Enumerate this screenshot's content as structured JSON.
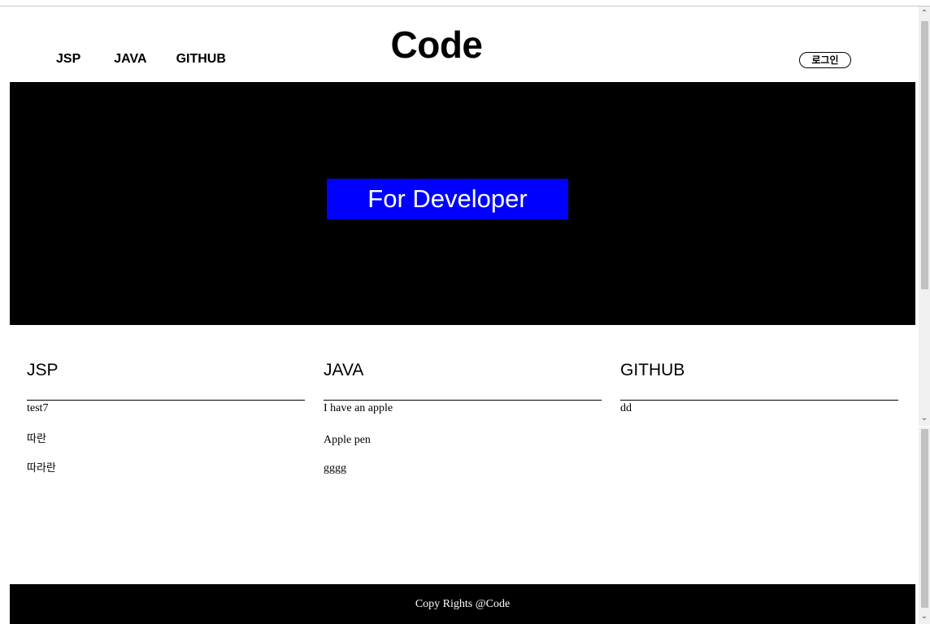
{
  "header": {
    "nav": [
      "JSP",
      "JAVA",
      "GITHUB"
    ],
    "logo": "Code",
    "login_label": "로그인"
  },
  "hero": {
    "tagline": "For Developer"
  },
  "sections": [
    {
      "title": "JSP",
      "items": [
        "test7",
        "따란",
        "따라란"
      ]
    },
    {
      "title": "JAVA",
      "items": [
        "I have an apple",
        "Apple pen",
        "gggg"
      ]
    },
    {
      "title": "GITHUB",
      "items": [
        "dd"
      ]
    }
  ],
  "footer": {
    "text": "Copy Rights @Code"
  },
  "scrollbar": {
    "up_icon": "chevron-up-icon",
    "down_icon": "chevron-down-icon"
  }
}
